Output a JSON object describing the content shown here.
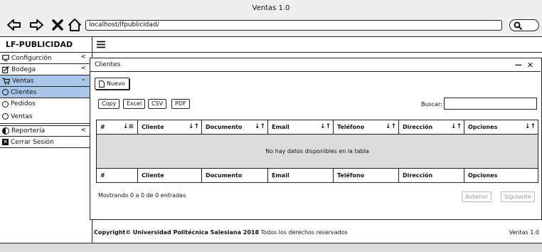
{
  "window": {
    "title": "Ventas 1.0"
  },
  "browser": {
    "url": "localhost/lfpublicidad/"
  },
  "app": {
    "brand": "LF-PUBLICIDAD"
  },
  "sidebar": {
    "items": [
      {
        "label": "Configurción",
        "icon": "monitor-icon"
      },
      {
        "label": "Bodega",
        "icon": "edit-icon"
      },
      {
        "label": "Ventas",
        "icon": "cart-icon"
      }
    ],
    "ventas_sub": [
      {
        "label": "Clientes",
        "active": true
      },
      {
        "label": "Pedidos",
        "active": false
      },
      {
        "label": "Ventas",
        "active": false
      }
    ],
    "bottom_items": [
      {
        "label": "Reportería",
        "icon": "half-circle-icon"
      },
      {
        "label": "Cerrar Sesión",
        "icon": "close-square-icon"
      }
    ]
  },
  "panel": {
    "title": "Clientes",
    "new_button": "Nuevo",
    "export_buttons": [
      "Copy",
      "Excel",
      "CSV",
      "PDF"
    ],
    "search_label": "Buscar:",
    "search_value": "",
    "table": {
      "columns": [
        "#",
        "Cliente",
        "Documento",
        "Email",
        "Teléfono",
        "Dirección",
        "Opciones"
      ],
      "empty_message": "No hay datos disponibles en la tabla"
    },
    "info": "Mostrando 0 a 0 de 0 entradas",
    "prev_button": "Anterior",
    "next_button": "Siguiente"
  },
  "footer": {
    "copyright_bold": "Copyright",
    "institution": "Universidad Politécnica Salesiana 2018",
    "rights": "Todos los derechos reservados",
    "version": "Ventas 1.0"
  },
  "colors": {
    "active_bg": "#a9c5e8",
    "empty_row_bg": "#dcdcdc"
  }
}
